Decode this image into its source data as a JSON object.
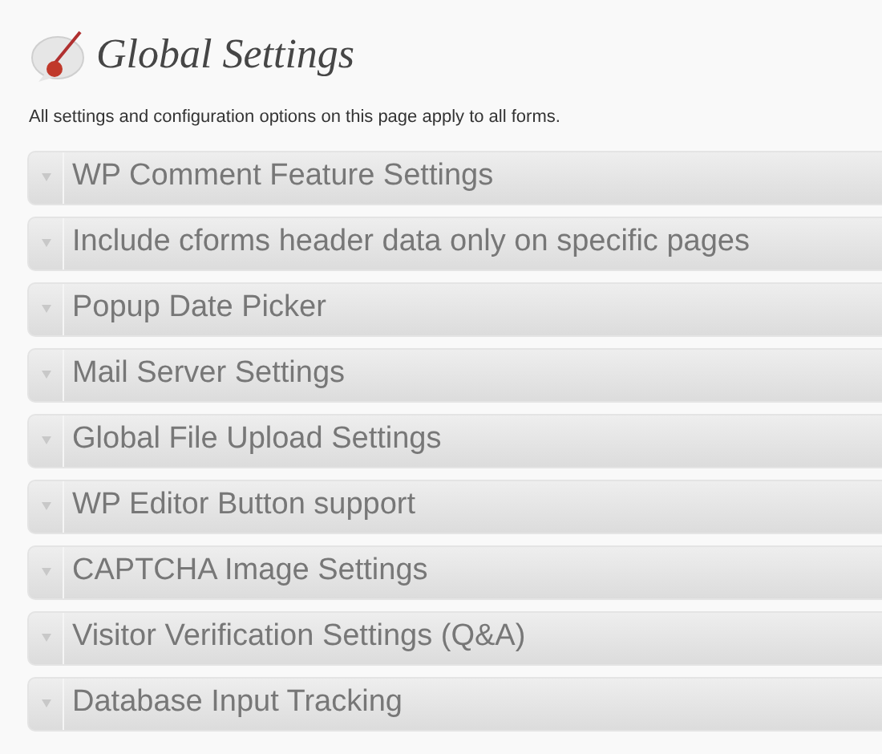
{
  "title": "Global Settings",
  "description": "All settings and configuration options on this page apply to all forms.",
  "sections": [
    {
      "label": "WP Comment Feature Settings",
      "expanded": false
    },
    {
      "label": "Include cforms header data only on specific pages",
      "expanded": false
    },
    {
      "label": "Popup Date Picker",
      "expanded": false
    },
    {
      "label": "Mail Server Settings",
      "expanded": false
    },
    {
      "label": "Global File Upload Settings",
      "expanded": false
    },
    {
      "label": "WP Editor Button support",
      "expanded": false
    },
    {
      "label": "CAPTCHA Image Settings",
      "expanded": false
    },
    {
      "label": "Visitor Verification Settings (Q&A)",
      "expanded": false
    },
    {
      "label": "Database Input Tracking",
      "expanded": false
    }
  ]
}
